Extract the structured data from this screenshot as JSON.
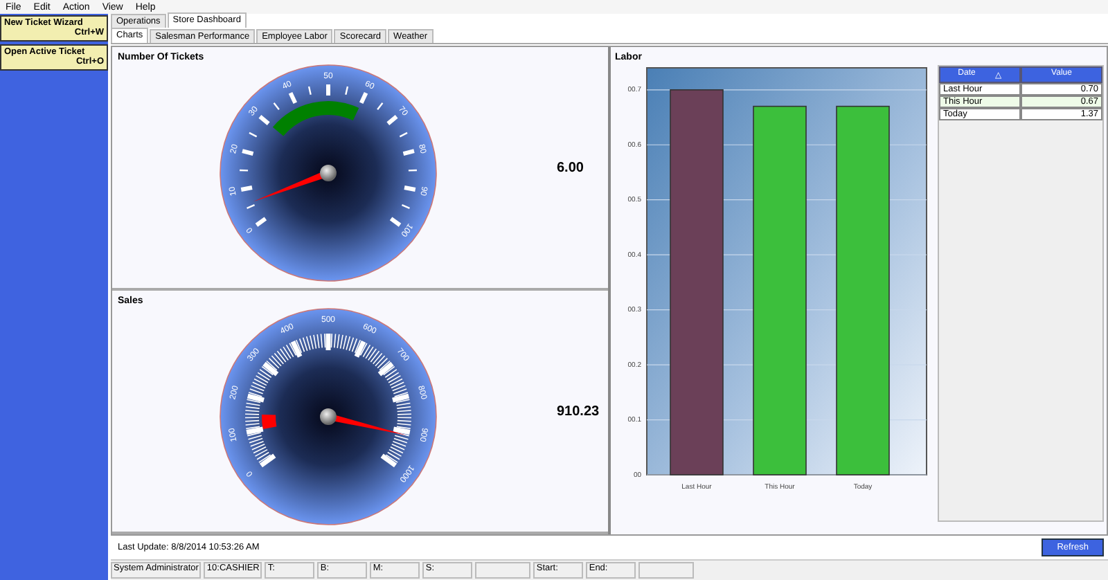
{
  "menu": [
    "File",
    "Edit",
    "Action",
    "View",
    "Help"
  ],
  "sidebar": {
    "items": [
      {
        "label": "New Ticket Wizard",
        "shortcut": "Ctrl+W"
      },
      {
        "label": "Open Active Ticket",
        "shortcut": "Ctrl+O"
      }
    ]
  },
  "tabs": [
    {
      "label": "Operations",
      "selected": false
    },
    {
      "label": "Store Dashboard",
      "selected": true
    }
  ],
  "subtabs": [
    {
      "label": "Charts",
      "selected": true
    },
    {
      "label": "Salesman Performance",
      "selected": false
    },
    {
      "label": "Employee Labor",
      "selected": false
    },
    {
      "label": "Scorecard",
      "selected": false
    },
    {
      "label": "Weather",
      "selected": false
    }
  ],
  "gauges": [
    {
      "title": "Number Of Tickets",
      "reading": "6.00",
      "scale_labels": [
        "0",
        "10",
        "20",
        "30",
        "40",
        "50",
        "60",
        "70",
        "80",
        "90",
        "100"
      ]
    },
    {
      "title": "Sales",
      "reading": "910.23",
      "scale_labels": [
        "0",
        "100",
        "200",
        "300",
        "400",
        "500",
        "600",
        "700",
        "800",
        "900",
        "1000"
      ]
    }
  ],
  "labor": {
    "title": "Labor",
    "chart_data": {
      "type": "bar",
      "categories": [
        "Last Hour",
        "This Hour",
        "Today"
      ],
      "values": [
        0.7,
        0.67,
        0.67
      ],
      "colors": [
        "#6b4058",
        "#3cbf3c",
        "#3cbf3c"
      ],
      "ylim": [
        0,
        0.74
      ],
      "grid": true,
      "yticks": [
        {
          "value": 0,
          "label": "00"
        },
        {
          "value": 0.1,
          "label": "00.1"
        },
        {
          "value": 0.2,
          "label": "00.2"
        },
        {
          "value": 0.3,
          "label": "00.3"
        },
        {
          "value": 0.4,
          "label": "00.4"
        },
        {
          "value": 0.5,
          "label": "00.5"
        },
        {
          "value": 0.6,
          "label": "00.6"
        },
        {
          "value": 0.7,
          "label": "00.7"
        }
      ]
    },
    "table": {
      "columns": [
        "Date",
        "Value"
      ],
      "sort_mark": "△",
      "rows": [
        {
          "date": "Last Hour",
          "value": "0.70",
          "selected": false
        },
        {
          "date": "This Hour",
          "value": "0.67",
          "selected": true
        },
        {
          "date": "Today",
          "value": "1.37",
          "selected": false
        }
      ]
    }
  },
  "last_update": "Last Update: 8/8/2014 10:53:26 AM",
  "refresh_button": "Refresh",
  "status_bar": [
    "System Administrator",
    "10:CASHIER",
    "T:",
    "B:",
    "M:",
    "S:",
    "Start:",
    "End:"
  ]
}
